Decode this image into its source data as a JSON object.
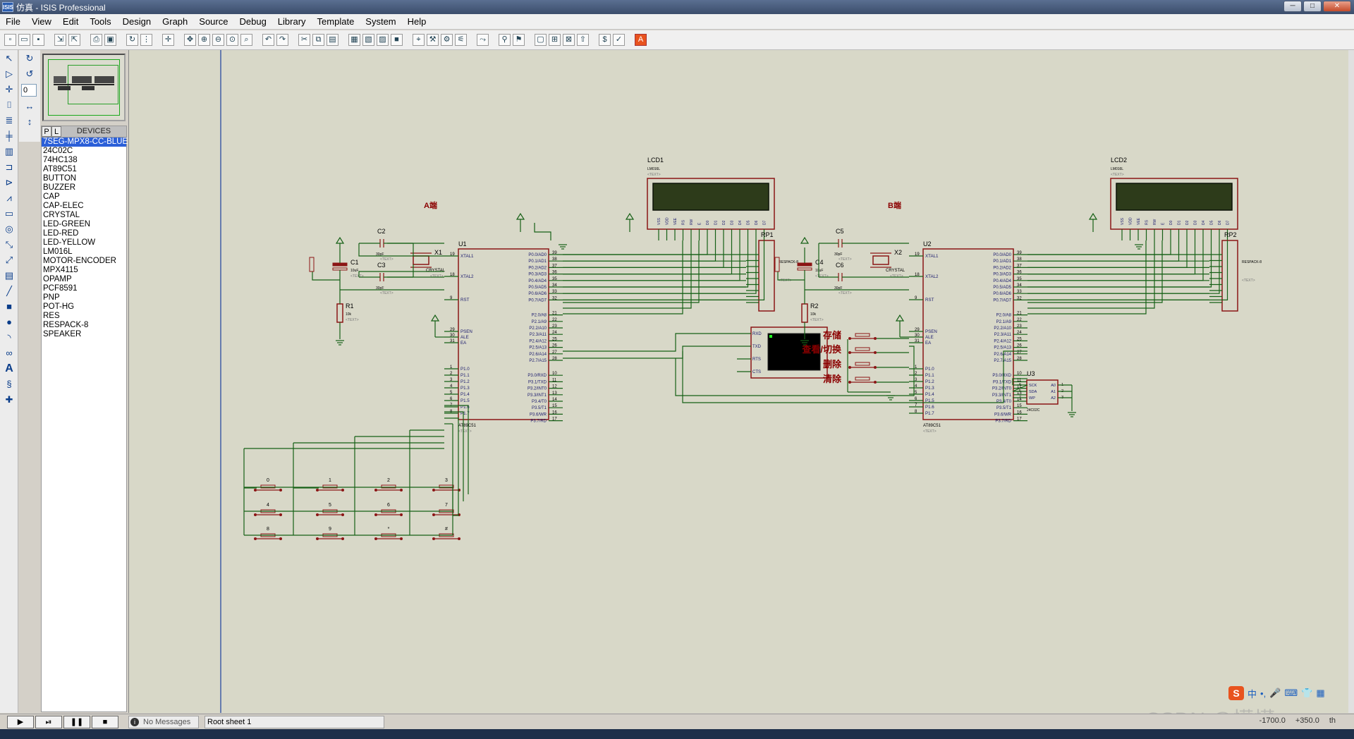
{
  "window": {
    "title": "仿真 - ISIS Professional",
    "app_icon": "ISIS",
    "minimize": "─",
    "maximize": "□",
    "close": "✕"
  },
  "menu": [
    "File",
    "View",
    "Edit",
    "Tools",
    "Design",
    "Graph",
    "Source",
    "Debug",
    "Library",
    "Template",
    "System",
    "Help"
  ],
  "device_panel": {
    "p_button": "P",
    "l_button": "L",
    "title": "DEVICES",
    "rotation_value": "0",
    "selected_index": 0,
    "items": [
      "7SEG-MPX8-CC-BLUE",
      "24C02C",
      "74HC138",
      "AT89C51",
      "BUTTON",
      "BUZZER",
      "CAP",
      "CAP-ELEC",
      "CRYSTAL",
      "LED-GREEN",
      "LED-RED",
      "LED-YELLOW",
      "LM016L",
      "MOTOR-ENCODER",
      "MPX4115",
      "OPAMP",
      "PCF8591",
      "PNP",
      "POT-HG",
      "RES",
      "RESPACK-8",
      "SPEAKER"
    ]
  },
  "schematic": {
    "side_a": "A端",
    "side_b": "B端",
    "text_placeholder": "<TEXT>",
    "lcd1": {
      "ref": "LCD1",
      "part": "LM016L"
    },
    "lcd2": {
      "ref": "LCD2",
      "part": "LM016L"
    },
    "lcd_pins": [
      "VSS",
      "VDD",
      "VEE",
      "RS",
      "RW",
      "E",
      "D0",
      "D1",
      "D2",
      "D3",
      "D4",
      "D5",
      "D6",
      "D7"
    ],
    "rp1": {
      "ref": "RP1",
      "part": "RESPACK-8"
    },
    "rp2": {
      "ref": "RP2",
      "part": "RESPACK-8"
    },
    "u1": {
      "ref": "U1",
      "part": "AT89C51"
    },
    "u2": {
      "ref": "U2",
      "part": "AT89C51"
    },
    "u3": {
      "ref": "U3",
      "part": "24C02C",
      "pins_left": [
        "SCK",
        "SDA",
        "WP"
      ],
      "pins_right": [
        "A0",
        "A1",
        "A2"
      ],
      "pin_nums_left": [
        "6",
        "5",
        "7"
      ],
      "pin_nums_right": [
        "1",
        "2",
        "3"
      ]
    },
    "mcu_left_pins": [
      "XTAL1",
      "XTAL2",
      "RST",
      "PSEN",
      "ALE",
      "EA",
      "P1.0",
      "P1.1",
      "P1.2",
      "P1.3",
      "P1.4",
      "P1.5",
      "P1.6",
      "P1.7"
    ],
    "mcu_left_nums": [
      "19",
      "18",
      "9",
      "29",
      "30",
      "31",
      "1",
      "2",
      "3",
      "4",
      "5",
      "6",
      "7",
      "8"
    ],
    "mcu_right_pins": [
      "P0.0/AD0",
      "P0.1/AD1",
      "P0.2/AD2",
      "P0.3/AD3",
      "P0.4/AD4",
      "P0.5/AD5",
      "P0.6/AD6",
      "P0.7/AD7",
      "P2.0/A8",
      "P2.1/A9",
      "P2.2/A10",
      "P2.3/A11",
      "P2.4/A12",
      "P2.5/A13",
      "P2.6/A14",
      "P2.7/A15",
      "P3.0/RXD",
      "P3.1/TXD",
      "P3.2/INT0",
      "P3.3/INT1",
      "P3.4/T0",
      "P3.5/T1",
      "P3.6/WR",
      "P3.7/RD"
    ],
    "mcu_right_nums": [
      "39",
      "38",
      "37",
      "36",
      "35",
      "34",
      "33",
      "32",
      "21",
      "22",
      "23",
      "24",
      "25",
      "26",
      "27",
      "28",
      "10",
      "11",
      "12",
      "13",
      "14",
      "15",
      "16",
      "17"
    ],
    "c1": {
      "ref": "C1",
      "val": "10uF"
    },
    "c2": {
      "ref": "C2",
      "val": "30pF"
    },
    "c3": {
      "ref": "C3",
      "val": "30pF"
    },
    "c4": {
      "ref": "C4",
      "val": "10uF"
    },
    "c5": {
      "ref": "C5",
      "val": "30pF"
    },
    "c6": {
      "ref": "C6",
      "val": "30pF"
    },
    "x1": {
      "ref": "X1",
      "val": "CRYSTAL"
    },
    "x2": {
      "ref": "X2",
      "val": "CRYSTAL"
    },
    "r1": {
      "ref": "R1",
      "val": "10k"
    },
    "r2": {
      "ref": "R2",
      "val": "10k"
    },
    "terminal_pins": [
      "RXD",
      "TXD",
      "RTS",
      "CTS"
    ],
    "keypad_labels": [
      "0",
      "1",
      "2",
      "3",
      "4",
      "5",
      "6",
      "7",
      "8",
      "9",
      "*",
      "#"
    ],
    "b_button_labels": [
      "存储",
      "查看/切换",
      "删除",
      "清除"
    ]
  },
  "status": {
    "play": "▶",
    "step": "⏯",
    "pause": "❚❚",
    "stop": "■",
    "messages": "No Messages",
    "info_icon": "i",
    "sheet": "Root sheet 1",
    "x": "-1700.0",
    "y": "+350.0",
    "unit": "th"
  },
  "ime": {
    "logo": "S",
    "lang": "中",
    "punct": "•,",
    "mic": "🎤",
    "keyboard": "⌨",
    "shirt": "👕",
    "grid": "▦"
  },
  "watermark": "CSDN @懵懂......",
  "colors": {
    "canvas": "#d8d8c8",
    "wire": "#166016",
    "component": "#8b1515",
    "pin_text": "#1a1a6e",
    "selected": "#2b5fd8"
  }
}
